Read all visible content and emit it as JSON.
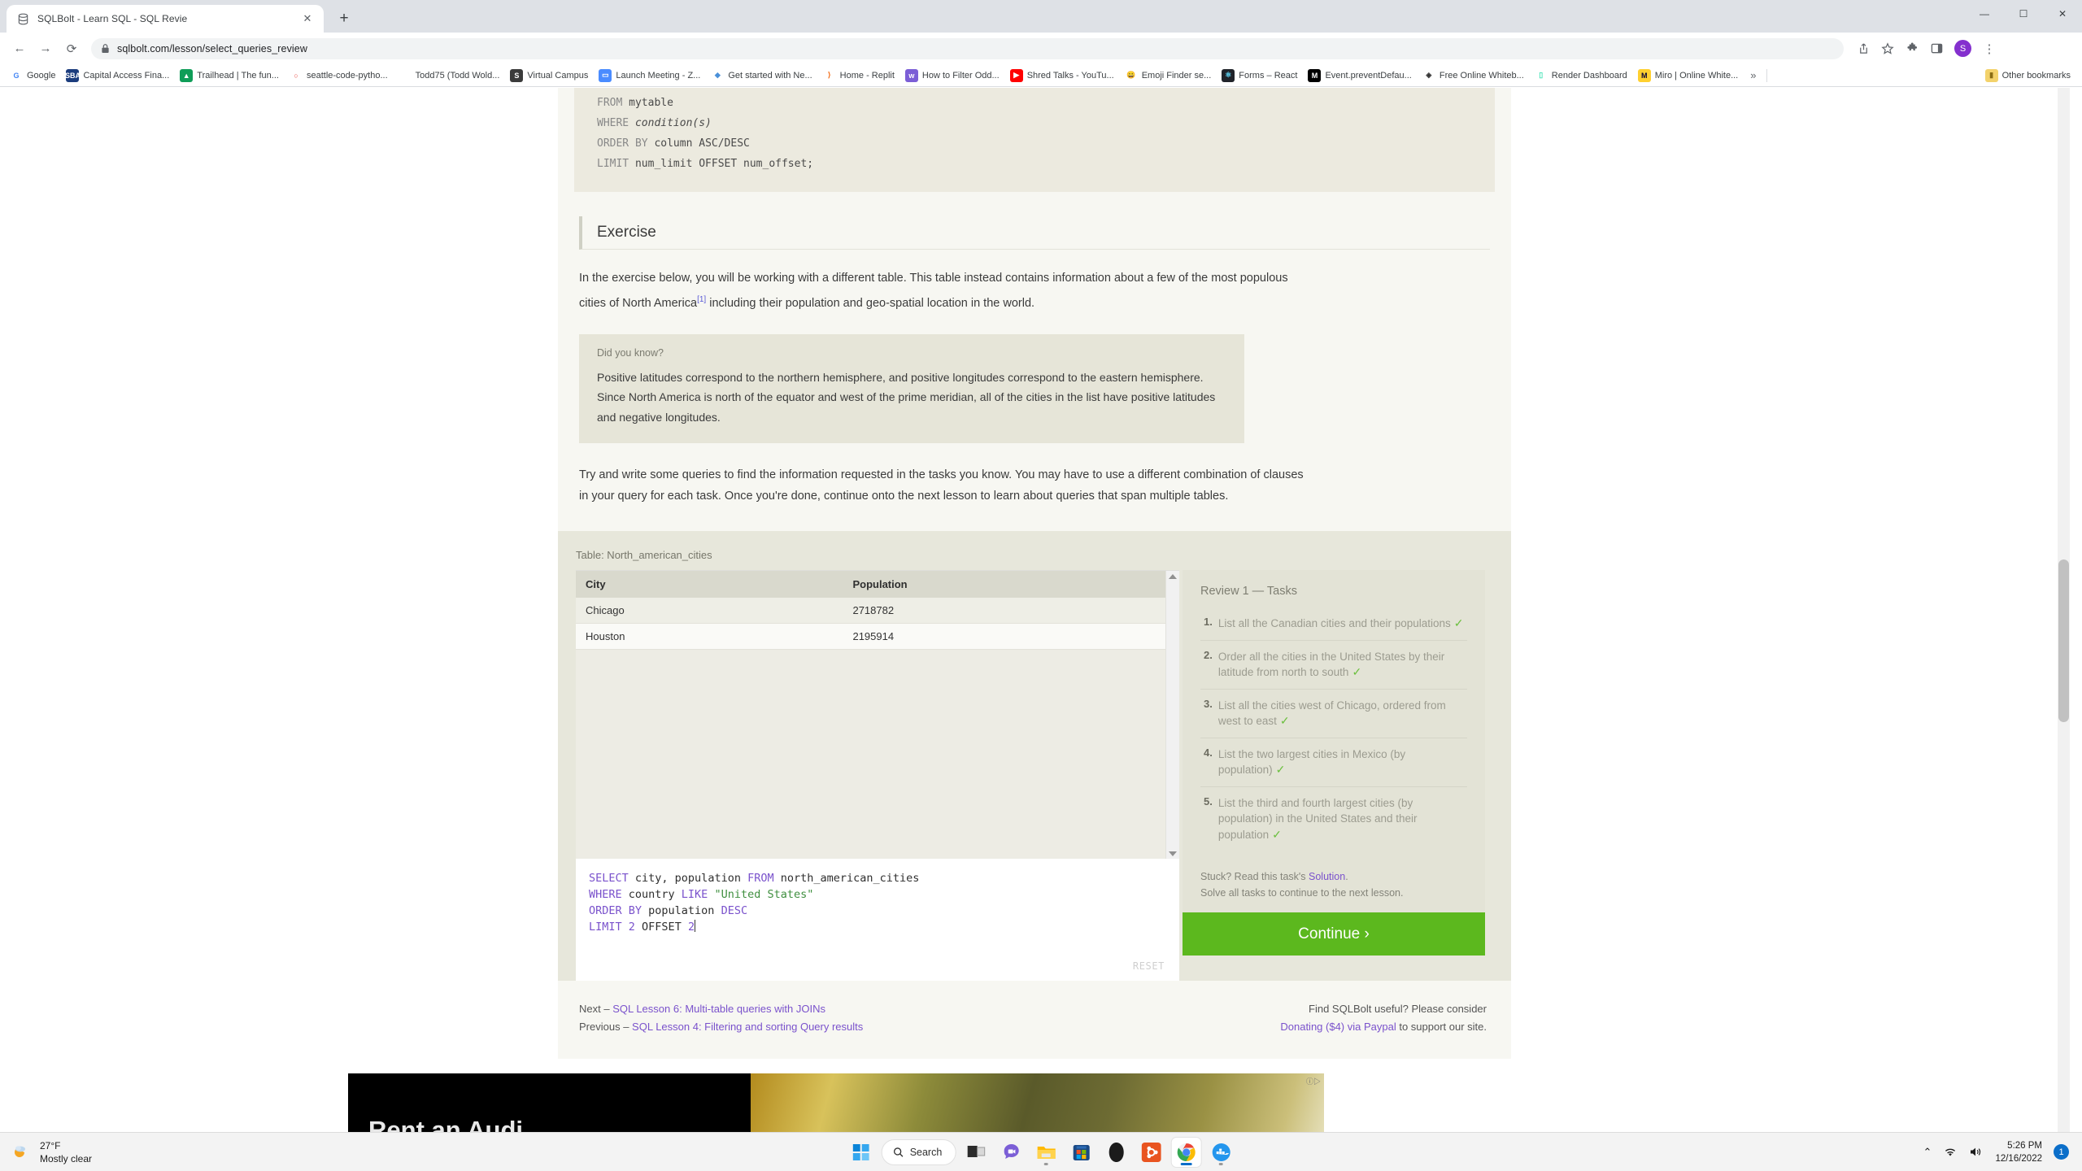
{
  "browser": {
    "tab": {
      "title": "SQLBolt - Learn SQL - SQL Revie",
      "close_label": "✕",
      "favicon": "database-icon"
    },
    "new_tab_label": "+",
    "window_controls": {
      "minimize": "—",
      "maximize": "☐",
      "close": "✕"
    },
    "nav": {
      "back": "←",
      "forward": "→",
      "reload": "⟳",
      "lock": "lock-icon"
    },
    "url": "sqlbolt.com/lesson/select_queries_review",
    "right_icons": {
      "share": "share-icon",
      "bookmark": "star-icon",
      "extensions": "puzzle-icon",
      "sidepanel": "side-panel-icon",
      "profile": "S",
      "menu": "⋮"
    },
    "bookmarks": [
      {
        "label": "Google",
        "icon": "G",
        "color": "#ffffff",
        "fg": "#4285f4"
      },
      {
        "label": "Capital Access Fina...",
        "icon": "SBA",
        "color": "#1b3c7d",
        "fg": "#ffffff"
      },
      {
        "label": "Trailhead | The fun...",
        "icon": "▲",
        "color": "#0f9d58",
        "fg": "#ffffff"
      },
      {
        "label": "seattle-code-pytho...",
        "icon": "○",
        "color": "#ffffff",
        "fg": "#e8453c"
      },
      {
        "label": "Todd75 (Todd Wold...",
        "icon": "",
        "color": "#ffffff",
        "fg": "#24292e"
      },
      {
        "label": "Virtual Campus",
        "icon": "S",
        "color": "#3b3b3b",
        "fg": "#ffffff"
      },
      {
        "label": "Launch Meeting - Z...",
        "icon": "▭",
        "color": "#4a8cff",
        "fg": "#ffffff"
      },
      {
        "label": "Get started with Ne...",
        "icon": "◆",
        "color": "#ffffff",
        "fg": "#4a90d9"
      },
      {
        "label": "Home - Replit",
        "icon": "⟩",
        "color": "#ffffff",
        "fg": "#f26207"
      },
      {
        "label": "How to Filter Odd...",
        "icon": "w",
        "color": "#7b5ed6",
        "fg": "#ffffff"
      },
      {
        "label": "Shred Talks - YouTu...",
        "icon": "▶",
        "color": "#ff0000",
        "fg": "#ffffff"
      },
      {
        "label": "Emoji Finder se...",
        "icon": "😀",
        "color": "#ffffff",
        "fg": "#f4c20d"
      },
      {
        "label": "Forms – React",
        "icon": "⚛",
        "color": "#20232a",
        "fg": "#61dafb"
      },
      {
        "label": "Event.preventDefau...",
        "icon": "M",
        "color": "#000000",
        "fg": "#ffffff"
      },
      {
        "label": "Free Online Whiteb...",
        "icon": "◈",
        "color": "#ffffff",
        "fg": "#333333"
      },
      {
        "label": "Render Dashboard",
        "icon": "▯",
        "color": "#ffffff",
        "fg": "#46e3b7"
      },
      {
        "label": "Miro | Online White...",
        "icon": "M",
        "color": "#ffd02f",
        "fg": "#050038"
      }
    ],
    "bookmarks_overflow": "»",
    "other_bookmarks": {
      "label": "Other bookmarks",
      "icon": "folder-icon"
    }
  },
  "lesson": {
    "code_snippet": {
      "lines": [
        {
          "kw": "FROM",
          "rest": " mytable",
          "italic": false
        },
        {
          "kw": "WHERE",
          "rest": " condition(s)",
          "italic": true
        },
        {
          "kw": "ORDER BY",
          "rest": " column ASC/DESC",
          "italic": false
        },
        {
          "kw": "LIMIT",
          "rest": " num_limit OFFSET num_offset;",
          "italic": false
        }
      ]
    },
    "exercise_heading": "Exercise",
    "intro_paragraph_a": "In the exercise below, you will be working with a different table. This table instead contains information about a few of the most populous cities of North America",
    "intro_footnote": "[1]",
    "intro_paragraph_b": " including their population and geo-spatial location in the world.",
    "did_you_know": {
      "title": "Did you know?",
      "body": "Positive latitudes correspond to the northern hemisphere, and positive longitudes correspond to the eastern hemisphere. Since North America is north of the equator and west of the prime meridian, all of the cities in the list have positive latitudes and negative longitudes."
    },
    "instructions": "Try and write some queries to find the information requested in the tasks you know. You may have to use a different combination of clauses in your query for each task. Once you're done, continue onto the next lesson to learn about queries that span multiple tables.",
    "table_label": "Table: North_american_cities",
    "results": {
      "columns": [
        "City",
        "Population"
      ],
      "rows": [
        [
          "Chicago",
          "2718782"
        ],
        [
          "Houston",
          "2195914"
        ]
      ]
    },
    "editor": {
      "lines": [
        [
          {
            "t": "SELECT",
            "c": "kw"
          },
          {
            "t": " city, population ",
            "c": "txt"
          },
          {
            "t": "FROM",
            "c": "kw"
          },
          {
            "t": " north_american_cities",
            "c": "txt"
          }
        ],
        [
          {
            "t": "WHERE",
            "c": "kw"
          },
          {
            "t": " country ",
            "c": "txt"
          },
          {
            "t": "LIKE",
            "c": "kw"
          },
          {
            "t": " ",
            "c": "txt"
          },
          {
            "t": "\"United States\"",
            "c": "str"
          }
        ],
        [
          {
            "t": "ORDER BY",
            "c": "kw"
          },
          {
            "t": " population ",
            "c": "txt"
          },
          {
            "t": "DESC",
            "c": "kw"
          }
        ],
        [
          {
            "t": "LIMIT",
            "c": "kw"
          },
          {
            "t": " ",
            "c": "txt"
          },
          {
            "t": "2",
            "c": "num"
          },
          {
            "t": " OFFSET ",
            "c": "txt"
          },
          {
            "t": "2",
            "c": "num"
          }
        ]
      ],
      "reset_label": "RESET"
    },
    "tasks": {
      "title": "Review 1 — Tasks",
      "items": [
        {
          "num": "1.",
          "text": "List all the Canadian cities and their populations",
          "done": "✓"
        },
        {
          "num": "2.",
          "text": "Order all the cities in the United States by their latitude from north to south",
          "done": "✓"
        },
        {
          "num": "3.",
          "text": "List all the cities west of Chicago, ordered from west to east",
          "done": "✓"
        },
        {
          "num": "4.",
          "text": "List the two largest cities in Mexico (by population)",
          "done": "✓"
        },
        {
          "num": "5.",
          "text": "List the third and fourth largest cities (by population) in the United States and their population",
          "done": "✓"
        }
      ]
    },
    "stuck": {
      "prefix": "Stuck? Read this task's ",
      "link": "Solution",
      "suffix": ".",
      "line2": "Solve all tasks to continue to the next lesson."
    },
    "continue_label": "Continue ›",
    "footer": {
      "next_prefix": "Next – ",
      "next_link": "SQL Lesson 6: Multi-table queries with JOINs",
      "prev_prefix": "Previous – ",
      "prev_link": "SQL Lesson 4: Filtering and sorting Query results",
      "support_line1": "Find SQLBolt useful? Please consider",
      "support_link": "Donating ($4) via Paypal",
      "support_suffix": " to support our site."
    }
  },
  "ad": {
    "headline": "Rent an Audi",
    "label": "ⓘ▷"
  },
  "taskbar": {
    "weather": {
      "temp": "27°F",
      "condition": "Mostly clear",
      "icon": "partly-cloudy-night-icon"
    },
    "search_label": "Search",
    "apps": [
      {
        "name": "start-button"
      },
      {
        "name": "search-pill"
      },
      {
        "name": "task-view"
      },
      {
        "name": "teams-chat"
      },
      {
        "name": "file-explorer"
      },
      {
        "name": "microsoft-store"
      },
      {
        "name": "alienware"
      },
      {
        "name": "ubuntu"
      },
      {
        "name": "google-chrome"
      },
      {
        "name": "docker"
      }
    ],
    "tray": {
      "chevron": "⌃",
      "wifi": "wifi-icon",
      "volume": "volume-icon",
      "time": "5:26 PM",
      "date": "12/16/2022",
      "notifications": "1"
    }
  },
  "colors": {
    "accent_green": "#5cb81e",
    "link_purple": "#7a52cc",
    "card_bg": "#f7f7f2",
    "panel_bg": "#e7e7db",
    "code_bg": "#eceadf"
  }
}
